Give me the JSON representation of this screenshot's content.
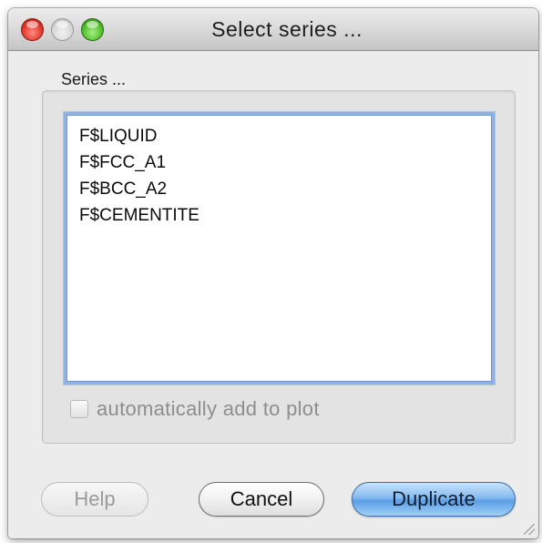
{
  "window": {
    "title": "Select series ..."
  },
  "series_group": {
    "label": "Series ...",
    "items": [
      {
        "label": "F$LIQUID"
      },
      {
        "label": "F$FCC_A1"
      },
      {
        "label": "F$BCC_A2"
      },
      {
        "label": "F$CEMENTITE"
      }
    ]
  },
  "options": {
    "auto_add_label": "automatically add to plot",
    "auto_add_checked": false,
    "auto_add_enabled": false
  },
  "buttons": {
    "help": "Help",
    "cancel": "Cancel",
    "duplicate": "Duplicate"
  },
  "colors": {
    "default_button": "#5b9ee6",
    "close_light": "#e2392c",
    "zoom_light": "#4fc02a"
  }
}
